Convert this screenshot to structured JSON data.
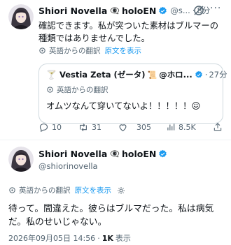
{
  "tweet1": {
    "display_name": "Shiori Novella",
    "emoji": "👁‍🗨",
    "handle_suffix": "holoEN",
    "handle": "@s...",
    "time_sep": "·",
    "time": "8分",
    "text": "確認できます。私が突ついた素材はブルマーの種類ではありませんでした。"
  },
  "quote": {
    "prefix_emoji": "🍸",
    "display_name": "Vestia Zeta (ゼータ)",
    "name_emoji": "📜",
    "handle": "@ホロ...",
    "time_sep": "·",
    "time": "27分",
    "translated_label": "英語からの翻訳",
    "text": "オムツなんて穿いてないよ！！！！！😖"
  },
  "translate": {
    "label": "英語からの翻訳",
    "show_original": "原文を表示"
  },
  "actions": {
    "reply_count": "10",
    "retweet_count": "31",
    "like_count": "305",
    "views_count": "8.5K"
  },
  "tweet2": {
    "display_name": "Shiori Novella",
    "emoji": "👁‍🗨",
    "handle_suffix": "holoEN",
    "handle": "@shiorinovella",
    "text": "待って。間違えた。彼らはブルマだった。私は病気だ。私のせいじゃない。",
    "timestamp": "2026年09月05日 14:56",
    "views_sep": "·",
    "views": "1K",
    "views_label": "表示"
  },
  "colors": {
    "link": "#1d9bf0",
    "muted": "#536471",
    "verified": "#1d9bf0",
    "border": "#cfd9de"
  }
}
